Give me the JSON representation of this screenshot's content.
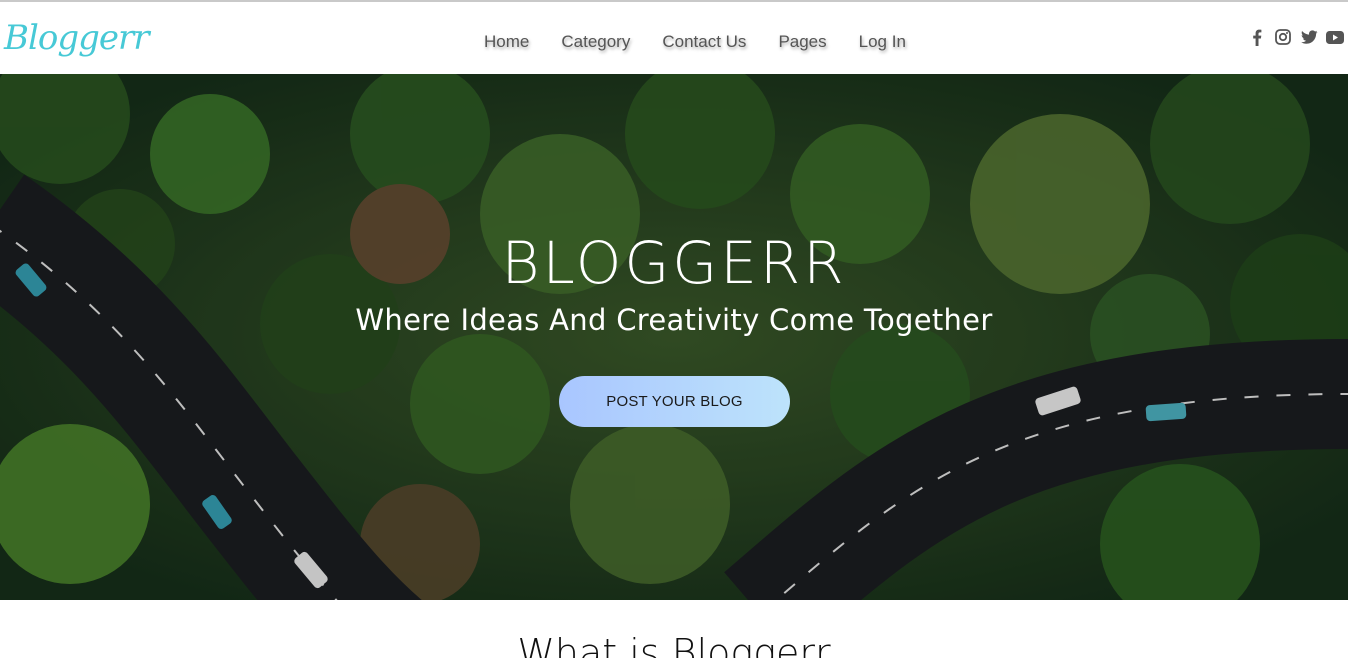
{
  "brand": {
    "logo_text": "Bloggerr",
    "accent_color": "#47c9d6"
  },
  "nav": {
    "items": [
      {
        "label": "Home"
      },
      {
        "label": "Category"
      },
      {
        "label": "Contact Us"
      },
      {
        "label": "Pages"
      },
      {
        "label": "Log In"
      }
    ]
  },
  "socials": [
    {
      "icon": "facebook-icon"
    },
    {
      "icon": "instagram-icon"
    },
    {
      "icon": "twitter-icon"
    },
    {
      "icon": "youtube-icon"
    }
  ],
  "hero": {
    "title": "BLOGGERR",
    "subtitle": "Where Ideas And Creativity Come Together",
    "button_label": "POST YOUR BLOG",
    "button_gradient": [
      "#a9c6ff",
      "#bde3fb"
    ]
  },
  "section": {
    "title": "What is Bloggerr"
  }
}
